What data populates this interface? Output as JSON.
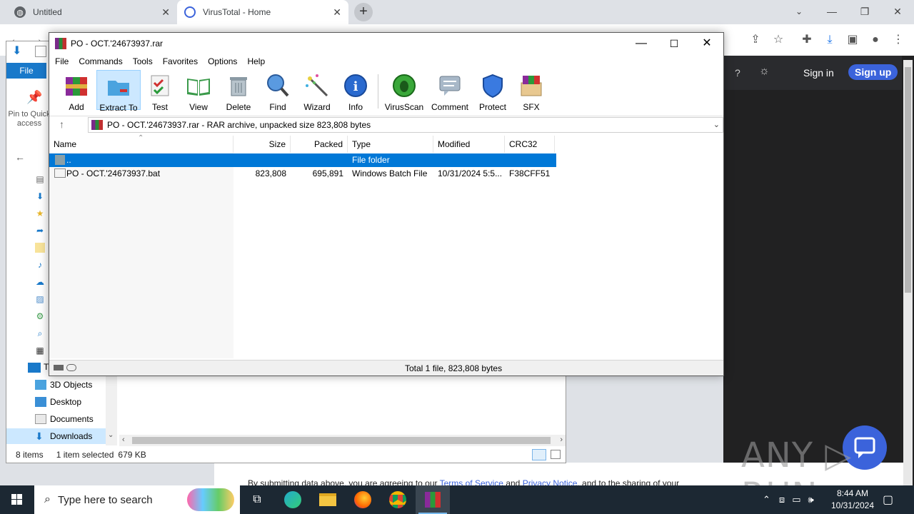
{
  "chrome": {
    "tabs": [
      {
        "title": "Untitled"
      },
      {
        "title": "VirusTotal - Home"
      }
    ],
    "new_tab": "+",
    "win_min": "—",
    "win_max": "❐",
    "win_close": "✕"
  },
  "virustotal": {
    "sign_in": "Sign in",
    "sign_up": "Sign up",
    "footer_prefix": "By submitting data above, you are agreeing to our ",
    "footer_tos": "Terms of Service",
    "footer_and": " and ",
    "footer_privacy": "Privacy Notice",
    "footer_suffix": ", and to the sharing of your",
    "watermark": "ANY ▷ RUN"
  },
  "explorer": {
    "file_tab": "File",
    "pin_label": "Pin to Quick access",
    "tree": [
      "3D Objects",
      "Desktop",
      "Documents",
      "Downloads"
    ],
    "tree_partial": "T",
    "status_items": "8 items",
    "status_selected": "1 item selected",
    "status_size": "679 KB"
  },
  "winrar": {
    "title": "PO - OCT.'24673937.rar",
    "menu": [
      "File",
      "Commands",
      "Tools",
      "Favorites",
      "Options",
      "Help"
    ],
    "tools": [
      "Add",
      "Extract To",
      "Test",
      "View",
      "Delete",
      "Find",
      "Wizard",
      "Info",
      "VirusScan",
      "Comment",
      "Protect",
      "SFX"
    ],
    "path": "PO - OCT.'24673937.rar - RAR archive, unpacked size 823,808 bytes",
    "columns": [
      "Name",
      "Size",
      "Packed",
      "Type",
      "Modified",
      "CRC32"
    ],
    "rows": [
      {
        "name": "..",
        "size": "",
        "packed": "",
        "type": "File folder",
        "modified": "",
        "crc": ""
      },
      {
        "name": "PO - OCT.'24673937.bat",
        "size": "823,808",
        "packed": "695,891",
        "type": "Windows Batch File",
        "modified": "10/31/2024 5:5...",
        "crc": "F38CFF51"
      }
    ],
    "status": "Total 1 file, 823,808 bytes"
  },
  "taskbar": {
    "search_placeholder": "Type here to search",
    "time": "8:44 AM",
    "date": "10/31/2024"
  },
  "colors": {
    "accent": "#0078d7",
    "vt_blue": "#3b63db",
    "taskbar": "#1c2833"
  }
}
